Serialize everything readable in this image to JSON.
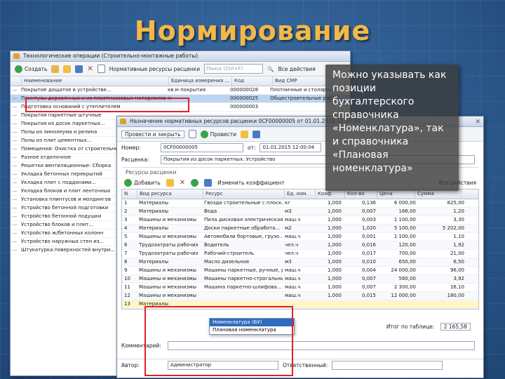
{
  "slide": {
    "title": "Нормирование"
  },
  "window1": {
    "title": "Технологические операции (Строительно-монтажные работы)",
    "toolbar": {
      "create": "Создать",
      "norm_resources": "Нормативные ресурсы расценки",
      "search_placeholder": "Поиск (Ctrl+F)",
      "all_actions": "Все действия"
    },
    "columns": [
      "Наименование",
      "Единица измерения ...",
      "Код",
      "Вид СМР"
    ],
    "rows": [
      {
        "name": "Покрытие дощатое в устройстве...",
        "unit": "кв.м покрытия",
        "code": "000000028",
        "type": "Плотничные и столярные"
      },
      {
        "name": "Плинтусы деревянные и из пластмассовых материалов",
        "unit": "м",
        "code": "000000025",
        "type": "Общестроительные работы"
      },
      {
        "name": "Подготовка оснований с утеплителем",
        "unit": "",
        "code": "000000003",
        "type": ""
      },
      {
        "name": "Покрытия паркетные штучные",
        "unit": "",
        "code": "",
        "type": ""
      },
      {
        "name": "Покрытия из досок паркетных...",
        "unit": "",
        "code": "",
        "type": ""
      },
      {
        "name": "Полы из линолеума и релина",
        "unit": "",
        "code": "",
        "type": ""
      },
      {
        "name": "Полы из плит цементных...",
        "unit": "",
        "code": "",
        "type": ""
      },
      {
        "name": "Помещения: Очистка от строительного...",
        "unit": "",
        "code": "",
        "type": ""
      },
      {
        "name": "Разное отделочное",
        "unit": "",
        "code": "",
        "type": ""
      },
      {
        "name": "Решетки вентиляционные: Сборка",
        "unit": "",
        "code": "",
        "type": ""
      },
      {
        "name": "Укладка бетонных перекрытий",
        "unit": "",
        "code": "",
        "type": ""
      },
      {
        "name": "Укладка плит с поддонами...",
        "unit": "",
        "code": "",
        "type": ""
      },
      {
        "name": "Укладка блоков и плит ленточных",
        "unit": "",
        "code": "",
        "type": ""
      },
      {
        "name": "Установка плинтусов и молдингов",
        "unit": "",
        "code": "",
        "type": ""
      },
      {
        "name": "Устройство бетонной подготовки",
        "unit": "",
        "code": "",
        "type": ""
      },
      {
        "name": "Устройство бетонной подушки",
        "unit": "",
        "code": "",
        "type": ""
      },
      {
        "name": "Устройство блоков и плит...",
        "unit": "",
        "code": "",
        "type": ""
      },
      {
        "name": "Устройство ж/бетонных колонн",
        "unit": "",
        "code": "",
        "type": ""
      },
      {
        "name": "Устройство наружных стен из...",
        "unit": "",
        "code": "",
        "type": ""
      },
      {
        "name": "Штукатурка поверхностей внутри...",
        "unit": "",
        "code": "",
        "type": ""
      }
    ]
  },
  "window2": {
    "title": "Назначение нормативных ресурсов расценки 0CF00000005 от 01.01.2015 12:00:00",
    "toolbar": {
      "post_close": "Провести и закрыть",
      "post": "Провести",
      "all_actions": "Все действия"
    },
    "number_label": "Номер:",
    "number_value": "0CF00000005",
    "date_label": "от:",
    "date_value": "01.01.2015 12:00:04",
    "rate_label": "Расценка:",
    "rate_value": "Покрытия из досок паркетных. Устройство",
    "group_label": "Ресурсы расценки",
    "sub_toolbar": {
      "add": "Добавить",
      "change_coef": "Изменить коэффициент",
      "all_actions": "Все действия"
    },
    "columns": [
      "N",
      "Вид ресурса",
      "Ресурс",
      "Ед. изм.",
      "Коэф.",
      "Кол-во",
      "Цена",
      "Сумма"
    ],
    "rows": [
      {
        "n": "1",
        "type": "Материалы",
        "res": "Гвозди строительные с плоск...",
        "unit": "кг",
        "k": "1,000",
        "q": "0,136",
        "price": "6 000,00",
        "sum": "825,00"
      },
      {
        "n": "2",
        "type": "Материалы",
        "res": "Вода",
        "unit": "м3",
        "k": "1,000",
        "q": "0,007",
        "price": "166,00",
        "sum": "1,20"
      },
      {
        "n": "3",
        "type": "Машины и механизмы",
        "res": "Пила дисковая электрическая",
        "unit": "маш.ч",
        "k": "1,000",
        "q": "0,003",
        "price": "1 100,00",
        "sum": "3,30"
      },
      {
        "n": "4",
        "type": "Материалы",
        "res": "Доски паркетные обработа...",
        "unit": "м2",
        "k": "1,000",
        "q": "1,020",
        "price": "5 100,00",
        "sum": "5 202,00"
      },
      {
        "n": "5",
        "type": "Машины и механизмы",
        "res": "Автомобили бортовые, грузо...",
        "unit": "маш.ч",
        "k": "1,000",
        "q": "0,001",
        "price": "1 100,00",
        "sum": "1,10"
      },
      {
        "n": "6",
        "type": "Трудозатраты рабочих",
        "res": "Водитель",
        "unit": "чел.ч",
        "k": "1,000",
        "q": "0,016",
        "price": "120,00",
        "sum": "1,92"
      },
      {
        "n": "7",
        "type": "Трудозатраты рабочих",
        "res": "Рабочий-строитель",
        "unit": "чел.ч",
        "k": "1,000",
        "q": "0,017",
        "price": "700,00",
        "sum": "21,00"
      },
      {
        "n": "8",
        "type": "Материалы",
        "res": "Масло дизельное",
        "unit": "м3",
        "k": "1,000",
        "q": "0,010",
        "price": "650,00",
        "sum": "6,50"
      },
      {
        "n": "9",
        "type": "Машины и механизмы",
        "res": "Машины паркетные, ручные, резчи...",
        "unit": "маш.ч",
        "k": "1,000",
        "q": "0,004",
        "price": "24 000,00",
        "sum": "96,00"
      },
      {
        "n": "10",
        "type": "Машины и механизмы",
        "res": "Машины паркетно-строгальные...",
        "unit": "маш.ч",
        "k": "1,000",
        "q": "0,007",
        "price": "560,00",
        "sum": "3,92"
      },
      {
        "n": "11",
        "type": "Машины и механизмы",
        "res": "Машина паркетно-шлифова...",
        "unit": "маш.ч",
        "k": "1,000",
        "q": "0,007",
        "price": "2 300,00",
        "sum": "16,10"
      },
      {
        "n": "12",
        "type": "Машины и механизмы",
        "res": "",
        "unit": "маш.ч",
        "k": "1,000",
        "q": "0,015",
        "price": "12 000,00",
        "sum": "180,00"
      },
      {
        "n": "13",
        "type": "Материалы",
        "res": "",
        "unit": "",
        "k": "",
        "q": "",
        "price": "",
        "sum": ""
      }
    ],
    "dropdown": [
      "Номенклатура (БУ)",
      "Плановая номенклатура"
    ],
    "total_label": "Итог по таблице:",
    "total_value": "2 165,58",
    "comment_label": "Комментарий:",
    "author_label": "Автор:",
    "author_value": "Администратор",
    "responsible_label": "Ответственный:"
  },
  "callout": {
    "text": "Можно указывать как позиции бухгалтерского справочника «Номенклатура», так и справочника «Плановая номенклатура»"
  },
  "colors": {
    "title": "#f2b84a",
    "highlight": "#e0202a",
    "background": "#2f5d93"
  }
}
